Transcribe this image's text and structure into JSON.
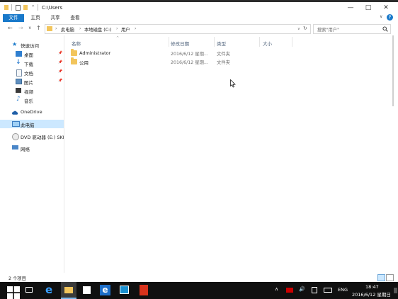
{
  "window": {
    "title": "C:\\Users",
    "buttons": {
      "minimize": "—",
      "maximize": "□",
      "close": "✕"
    }
  },
  "ribbon": {
    "tabs": [
      "文件",
      "主页",
      "共享",
      "查看"
    ],
    "expand": "∨",
    "help": "?"
  },
  "nav": {
    "back": "←",
    "forward": "→",
    "recent": "∨",
    "up": "↑",
    "breadcrumb": [
      "此电脑",
      "本地磁盘 (C:)",
      "用户"
    ],
    "dropdown": "∨",
    "refresh": "↻",
    "search_placeholder": "搜索\"用户\"",
    "search_icon": "search-icon"
  },
  "sidebar": {
    "items": [
      {
        "label": "快速访问",
        "icon": "star-icon"
      },
      {
        "label": "桌面",
        "icon": "desktop-icon",
        "pinned": true
      },
      {
        "label": "下载",
        "icon": "download-icon",
        "pinned": true
      },
      {
        "label": "文档",
        "icon": "document-icon",
        "pinned": true
      },
      {
        "label": "图片",
        "icon": "pictures-icon",
        "pinned": true
      },
      {
        "label": "视频",
        "icon": "video-icon"
      },
      {
        "label": "音乐",
        "icon": "music-icon"
      },
      {
        "label": "OneDrive",
        "icon": "cloud-icon"
      },
      {
        "label": "此电脑",
        "icon": "computer-icon",
        "selected": true
      },
      {
        "label": "DVD 驱动器 (E:) SKF",
        "icon": "dvd-icon"
      },
      {
        "label": "网络",
        "icon": "network-icon"
      }
    ]
  },
  "content": {
    "columns": [
      "名称",
      "修改日期",
      "类型",
      "大小"
    ],
    "rows": [
      {
        "name": "Administrator",
        "date": "2016/6/12 星期...",
        "type": "文件夹"
      },
      {
        "name": "公用",
        "date": "2016/6/12 星期...",
        "type": "文件夹"
      }
    ]
  },
  "status": {
    "count": "2 个项目"
  },
  "taskbar": {
    "lang": "ENG",
    "time": "18:47",
    "date": "2016/6/12 星期日",
    "tray_arrow": "∧"
  },
  "colors": {
    "accent": "#1979ca",
    "selected": "#cce8ff",
    "folder": "#f2c55c",
    "taskbar": "#101010"
  }
}
